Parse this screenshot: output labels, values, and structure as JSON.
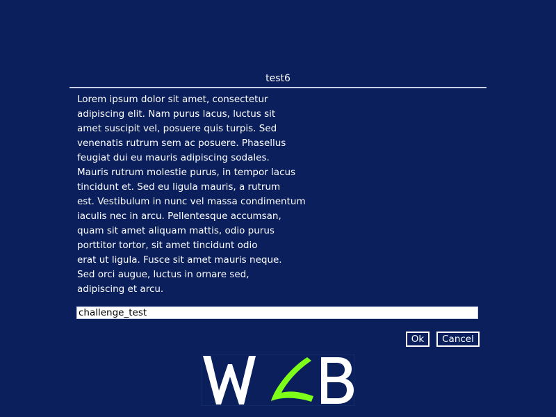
{
  "dialog": {
    "title": "test6",
    "message_lines": [
      "Lorem ipsum dolor sit amet, consectetur",
      "adipiscing elit. Nam purus lacus, luctus sit",
      "amet suscipit vel, posuere quis turpis. Sed",
      "venenatis rutrum sem ac posuere. Phasellus",
      "feugiat dui eu mauris adipiscing sodales.",
      "Mauris rutrum molestie purus, in tempor lacus",
      "tincidunt et. Sed eu ligula mauris, a rutrum",
      "est. Vestibulum in nunc vel massa condimentum",
      "iaculis nec in arcu. Pellentesque accumsan,",
      "quam sit amet aliquam mattis, odio purus",
      "porttitor tortor, sit amet tincidunt odio",
      "erat ut ligula. Fusce sit amet mauris neque.",
      "Sed orci augue, luctus in ornare sed,",
      "adipiscing et arcu."
    ],
    "input_value": "challenge_test",
    "ok_label": "Ok",
    "cancel_label": "Cancel"
  },
  "logo": {
    "icon": "wab-logo-icon",
    "letters": [
      "W",
      "A",
      "B"
    ],
    "colors": {
      "w": "#ffffff",
      "a": "#7dff1a",
      "b": "#ffffff"
    }
  },
  "colors": {
    "background": "#0a1f5c",
    "text": "#ffffff",
    "rule": "#c8d0e8",
    "input_background": "#ffffff"
  }
}
